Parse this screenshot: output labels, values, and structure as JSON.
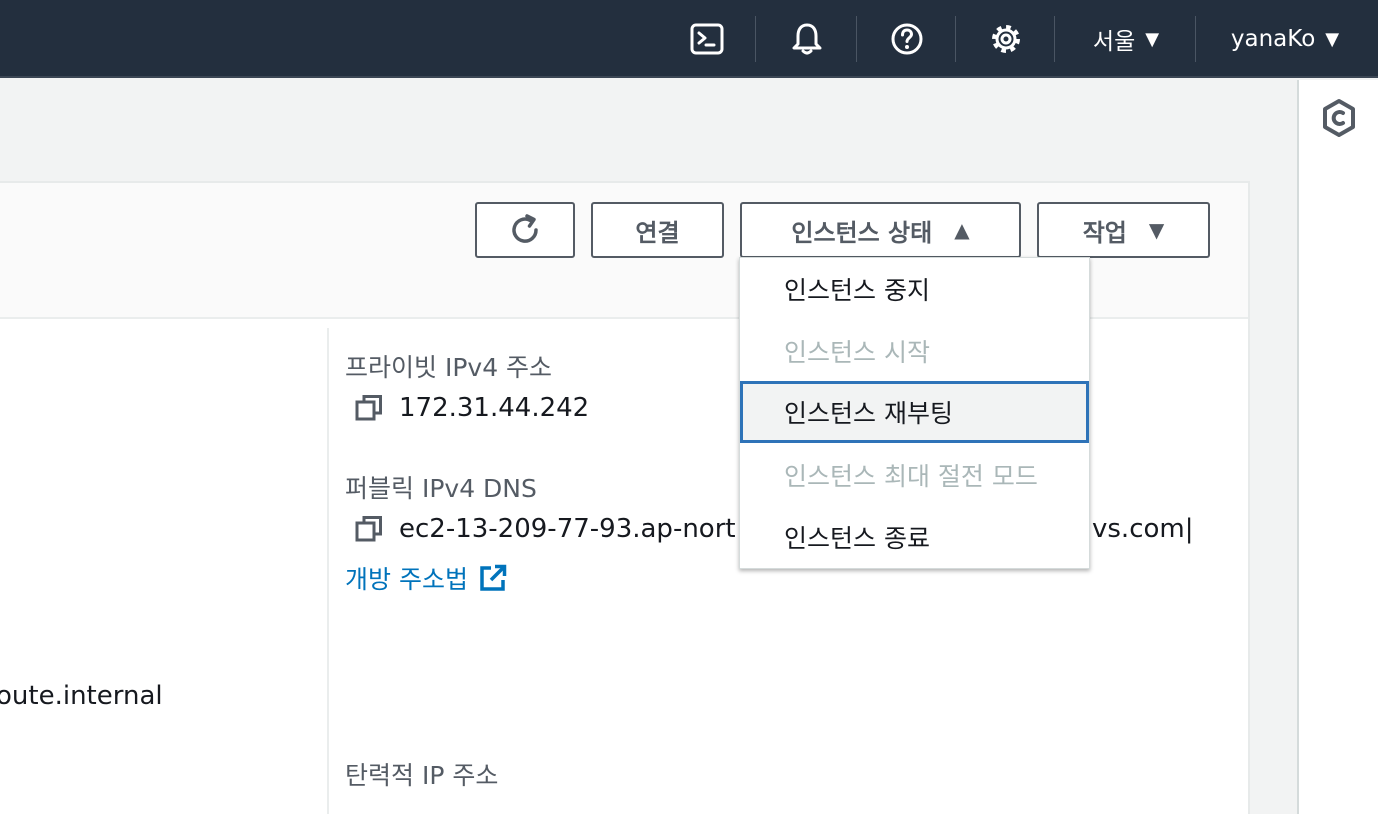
{
  "topbar": {
    "region_label": "서울",
    "user_label": "yanaKo",
    "icons": [
      "cloudshell-icon",
      "bell-icon",
      "help-icon",
      "settings-icon"
    ]
  },
  "toolbar": {
    "connect_label": "연결",
    "instance_state_label": "인스턴스 상태",
    "actions_label": "작업"
  },
  "instance_state_menu": {
    "items": [
      {
        "label": "인스턴스 중지",
        "state": "enabled"
      },
      {
        "label": "인스턴스 시작",
        "state": "disabled"
      },
      {
        "label": "인스턴스 재부팅",
        "state": "focused"
      },
      {
        "label": "인스턴스 최대 절전 모드",
        "state": "disabled"
      },
      {
        "label": "인스턴스 종료",
        "state": "enabled"
      }
    ]
  },
  "details": {
    "left_partial_value": "oute.internal",
    "private_ipv4_label": "프라이빗 IPv4 주소",
    "private_ipv4_value": "172.31.44.242",
    "public_dns_label": "퍼블릭 IPv4 DNS",
    "public_dns_value_visible_start": "ec2-13-209-77-93.ap-nort",
    "public_dns_value_visible_end": "vs.com|",
    "open_address_link": "개방 주소법",
    "elastic_ip_label": "탄력적 IP 주소"
  },
  "colors": {
    "topbar_bg": "#232f3e",
    "link": "#0073bb",
    "focus_border": "#2e73b8",
    "disabled_text": "#aab7b8"
  }
}
